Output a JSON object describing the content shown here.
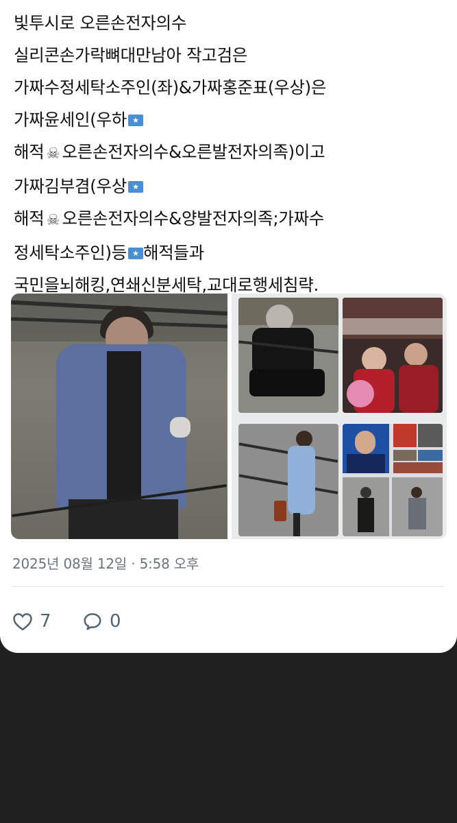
{
  "post": {
    "lines": [
      "빛투시로 오른손전자의수",
      "실리콘손가락뼈대만남아 작고검은",
      "가짜수정세탁소주인(좌)&가짜홍준표(우상)은",
      "가짜윤세인(우하",
      "해적",
      "오른손전자의수&오른발전자의족)이고",
      "가짜김부겸(우상",
      "해적",
      "오른손전자의수&양발전자의족;가짜수",
      "정세탁소주인)등",
      "해적들과",
      "국민을뇌해킹,연쇄신분세탁,교대로행세침략."
    ],
    "timestamp": "2025년 08월 12일 · 5:58 오후",
    "likes": "7",
    "replies": "0"
  },
  "icons": {
    "flag": "flag-icon",
    "skull": "skull-crossbones-icon",
    "like": "heart-icon",
    "reply": "reply-bubble-icon"
  },
  "colors": {
    "card_bg": "#ffffff",
    "page_bg": "#1f1f1f",
    "text": "#111111",
    "meta": "#6b7280",
    "icon": "#536471",
    "flag": "#4a8fd1"
  }
}
